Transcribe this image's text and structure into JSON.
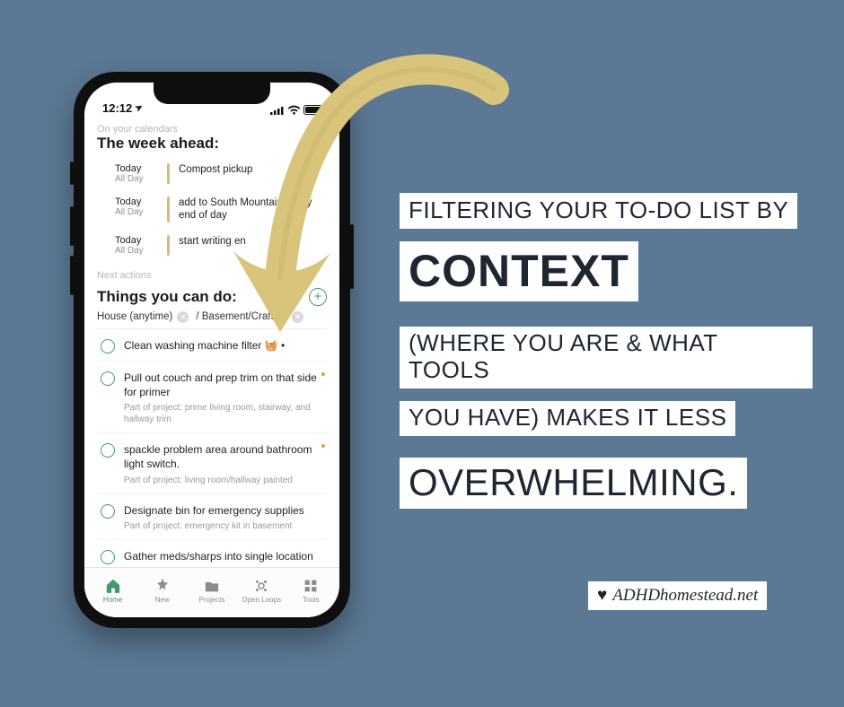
{
  "status": {
    "time": "12:12",
    "nav_glyph": "➤"
  },
  "calendar": {
    "label": "On your calendars",
    "title": "The week ahead:",
    "events": [
      {
        "t1": "Today",
        "t2": "All Day",
        "text": "Compost pickup"
      },
      {
        "t1": "Today",
        "t2": "All Day",
        "text": "add to South Mountain list by end of day"
      },
      {
        "t1": "Today",
        "t2": "All Day",
        "text": "start writing en"
      }
    ]
  },
  "actions": {
    "label": "Next actions",
    "title": "Things you can do:",
    "add_label": "+",
    "filters": [
      {
        "label": "House (anytime)"
      },
      {
        "label": "/ Basement/Crafting"
      }
    ],
    "tasks": [
      {
        "title": "Clean washing machine filter 🧺 •",
        "sub": ""
      },
      {
        "title": "Pull out couch and prep trim on that side for primer",
        "sub": "Part of project: prime living room, stairway, and hallway trim"
      },
      {
        "title": "spackle problem area around bathroom light switch.",
        "sub": "Part of project: living room/hallway painted"
      },
      {
        "title": "Designate bin for emergency supplies",
        "sub": "Part of project: emergency kit in basement"
      },
      {
        "title": "Gather meds/sharps into single location",
        "sub": ""
      }
    ]
  },
  "tabs": [
    {
      "label": "Home"
    },
    {
      "label": "New"
    },
    {
      "label": "Projects"
    },
    {
      "label": "Open Loops"
    },
    {
      "label": "Tools"
    }
  ],
  "headline": {
    "l1": "Filtering your to-do list by",
    "l2": "context",
    "l3": "(where you are & what tools",
    "l4": "you have) makes it less",
    "l5": "overwhelming."
  },
  "credit": {
    "heart": "♥",
    "text": "ADHDhomestead.net"
  },
  "colors": {
    "accent": "#3f9b6d",
    "arrow": "#d8c47a",
    "bg": "#5b7894"
  }
}
